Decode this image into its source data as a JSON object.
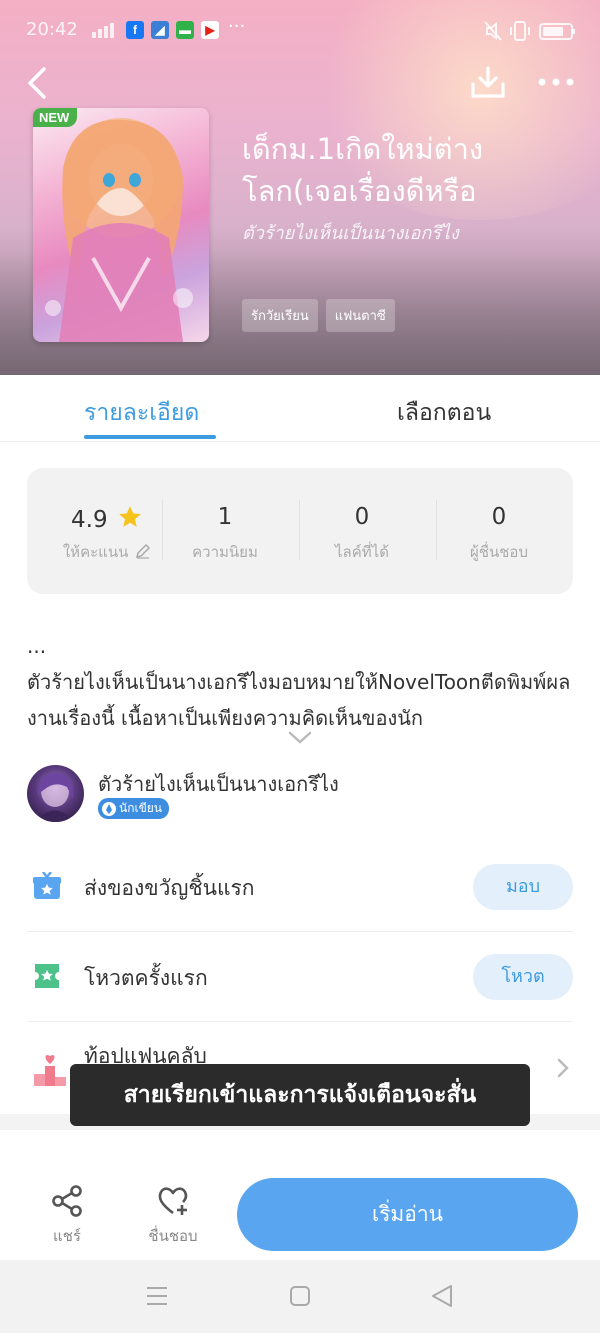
{
  "status_bar": {
    "time": "20:42",
    "more_indicator": "···",
    "app_icons": [
      "facebook-icon",
      "browser-icon",
      "chat-icon",
      "youtube-icon"
    ],
    "right_icons": [
      "mute-icon",
      "vibrate-icon",
      "battery-icon"
    ]
  },
  "header": {
    "badge": "NEW",
    "title": "เด็กม.1เกิดใหม่ต่างโลก(เจอเรื่องดีหรือ",
    "author": "ตัวร้ายไงเห็นเป็นนางเอกรึไง",
    "tags": [
      "รักวัยเรียน",
      "แฟนตาซี"
    ]
  },
  "tabs": [
    {
      "label": "รายละเอียด",
      "active": true
    },
    {
      "label": "เลือกตอน",
      "active": false
    }
  ],
  "stats": [
    {
      "value": "4.9",
      "label": "ให้คะแนน"
    },
    {
      "value": "1",
      "label": "ความนิยม"
    },
    {
      "value": "0",
      "label": "ไลค์ที่ได้"
    },
    {
      "value": "0",
      "label": "ผู้ชื่นชอบ"
    }
  ],
  "description": {
    "ellipsis": "...",
    "text": "ตัวร้ายไงเห็นเป็นนางเอกรึไงมอบหมายให้NovelToonตีดพิมพ์ผลงานเรื่องนี้ เนื้อหาเป็นเพียงความคิดเห็นของนัก"
  },
  "author_row": {
    "name": "ตัวร้ายไงเห็นเป็นนางเอกรึไง",
    "badge": "นักเขียน"
  },
  "actions": [
    {
      "label": "ส่งของขวัญชิ้นแรก",
      "button": "มอบ"
    },
    {
      "label": "โหวตครั้งแรก",
      "button": "โหวต"
    }
  ],
  "fanclub": {
    "label": "ท้อปแฟนคลับ"
  },
  "toast": "สายเรียกเข้าและการแจ้งเตือนจะสั่น",
  "bottom_bar": {
    "share": "แชร์",
    "favorite": "ชื่นชอบ",
    "read": "เริ่มอ่าน"
  },
  "colors": {
    "accent": "#3d9be0",
    "read_button": "#5aa5ef",
    "new_badge": "#49b04a",
    "star": "#f6c21c"
  }
}
